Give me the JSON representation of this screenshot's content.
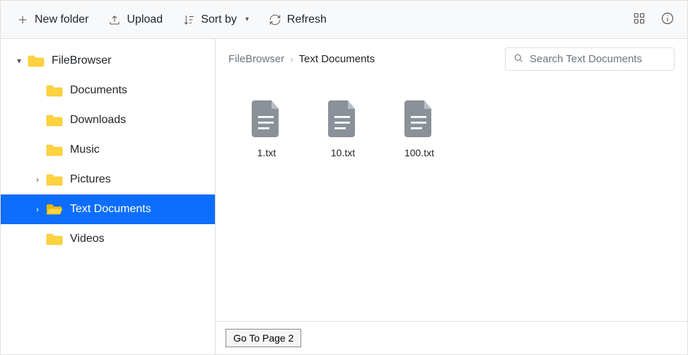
{
  "toolbar": {
    "new_folder": "New folder",
    "upload": "Upload",
    "sort_by": "Sort by",
    "refresh": "Refresh"
  },
  "tree": {
    "root": {
      "label": "FileBrowser",
      "expanded": true
    },
    "items": [
      {
        "label": "Documents",
        "has_children": false,
        "selected": false
      },
      {
        "label": "Downloads",
        "has_children": false,
        "selected": false
      },
      {
        "label": "Music",
        "has_children": false,
        "selected": false
      },
      {
        "label": "Pictures",
        "has_children": true,
        "selected": false
      },
      {
        "label": "Text Documents",
        "has_children": true,
        "selected": true
      },
      {
        "label": "Videos",
        "has_children": false,
        "selected": false
      }
    ]
  },
  "breadcrumb": {
    "parent": "FileBrowser",
    "current": "Text Documents"
  },
  "search": {
    "placeholder": "Search Text Documents"
  },
  "files": [
    {
      "name": "1.txt"
    },
    {
      "name": "10.txt"
    },
    {
      "name": "100.txt"
    }
  ],
  "footer": {
    "pager_label": "Go To Page 2"
  }
}
